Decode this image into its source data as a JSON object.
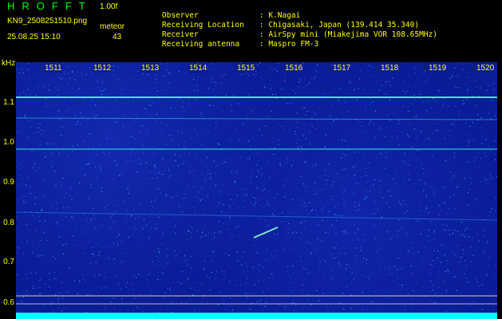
{
  "header": {
    "app_name": "HROFFT",
    "version": "1.00f",
    "filename": "KN9_2508251510.png",
    "mode": "meteor",
    "datetime": "25.08.25 15:10",
    "count": "43"
  },
  "info": [
    {
      "key": "Observer",
      "value": ": K.Nagai"
    },
    {
      "key": "Receiving Location",
      "value": ": Chigasaki, Japan (139.414 35.340)"
    },
    {
      "key": "Receiver",
      "value": ": AirSpy mini (Miakejima VOR 108.65MHz)"
    },
    {
      "key": "Receiving antenna",
      "value": ": Maspro FM-3"
    }
  ],
  "spectrogram": {
    "y_unit": "kHz",
    "y_ticks": [
      "1.1",
      "1.0",
      "0.9",
      "0.8",
      "0.7",
      "0.6"
    ],
    "x_ticks": [
      "1511",
      "1512",
      "1513",
      "1514",
      "1515",
      "1516",
      "1517",
      "1518",
      "1519",
      "1520"
    ],
    "colors": {
      "background": "#0a1c96",
      "signal": "#44ffdd",
      "text": "#ffff00",
      "title": "#00ff00"
    }
  }
}
